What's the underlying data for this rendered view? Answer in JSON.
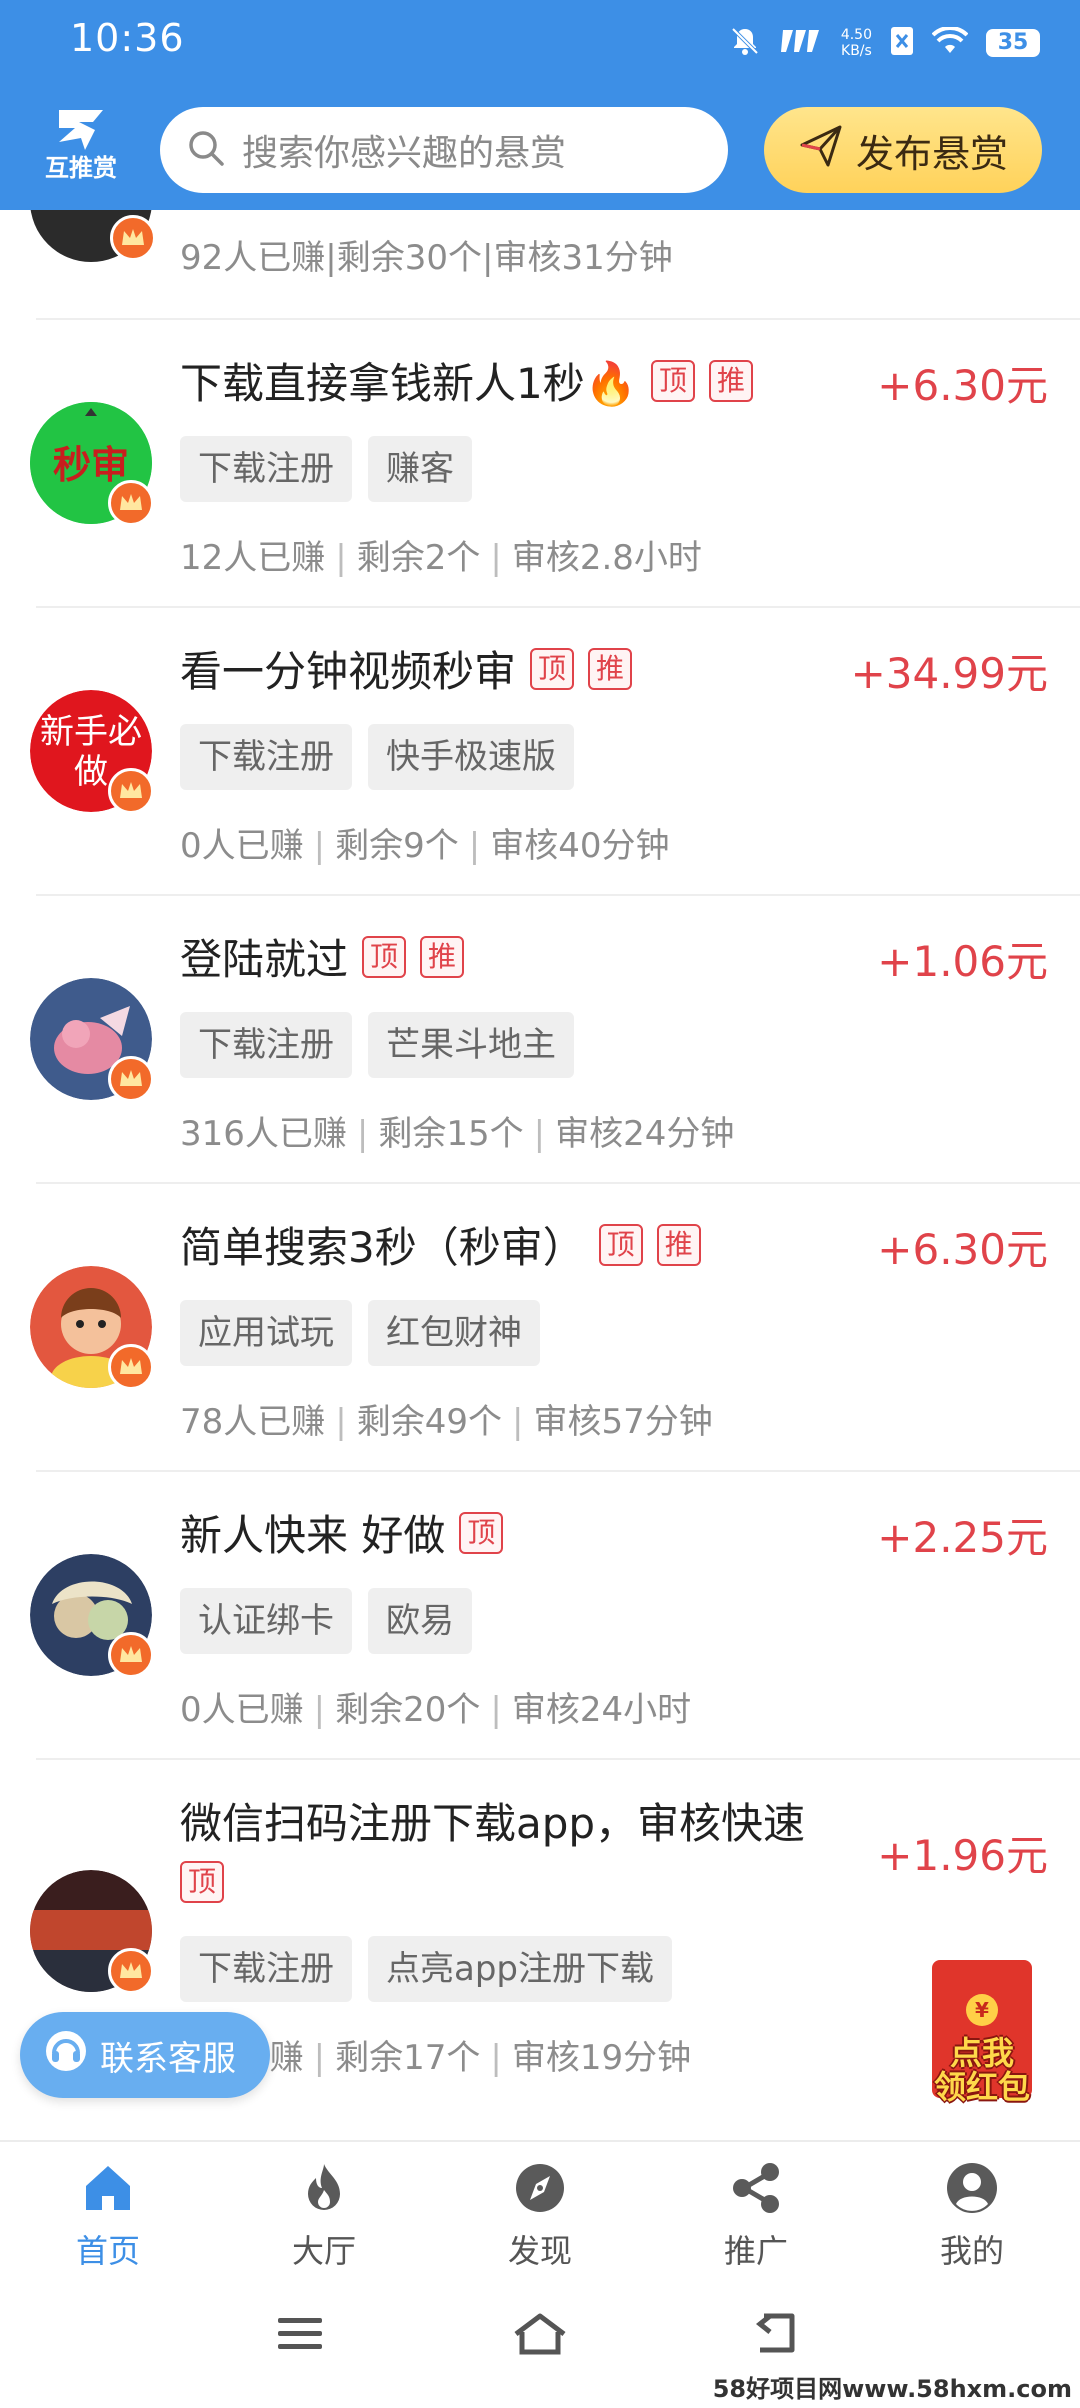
{
  "status_bar": {
    "time": "10:36",
    "net_speed_value": "4.50",
    "net_speed_unit": "KB/s",
    "battery": "35"
  },
  "header": {
    "logo_text": "互推赏",
    "search_placeholder": "搜索你感兴趣的悬赏",
    "publish_label": "发布悬赏"
  },
  "partial_row": {
    "earned": "92人已赚",
    "remaining": "剩余30个",
    "review": "审核31分钟"
  },
  "tasks": [
    {
      "title": "下载直接拿钱新人1秒🔥",
      "badges": [
        "顶",
        "推"
      ],
      "price": "+6.30元",
      "tags": [
        "下载注册",
        "赚客"
      ],
      "earned": "12人已赚",
      "remaining": "剩余2个",
      "review": "审核2.8小时",
      "avatar_text": "秒审"
    },
    {
      "title": "看一分钟视频秒审",
      "badges": [
        "顶",
        "推"
      ],
      "price": "+34.99元",
      "tags": [
        "下载注册",
        "快手极速版"
      ],
      "earned": "0人已赚",
      "remaining": "剩余9个",
      "review": "审核40分钟",
      "avatar_text": "新手必做"
    },
    {
      "title": "登陆就过",
      "badges": [
        "顶",
        "推"
      ],
      "price": "+1.06元",
      "tags": [
        "下载注册",
        "芒果斗地主"
      ],
      "earned": "316人已赚",
      "remaining": "剩余15个",
      "review": "审核24分钟"
    },
    {
      "title": "简单搜索3秒（秒审）",
      "badges": [
        "顶",
        "推"
      ],
      "price": "+6.30元",
      "tags": [
        "应用试玩",
        "红包财神"
      ],
      "earned": "78人已赚",
      "remaining": "剩余49个",
      "review": "审核57分钟"
    },
    {
      "title": "新人快来 好做",
      "badges": [
        "顶"
      ],
      "price": "+2.25元",
      "tags": [
        "认证绑卡",
        "欧易"
      ],
      "earned": "0人已赚",
      "remaining": "剩余20个",
      "review": "审核24小时"
    },
    {
      "title": "微信扫码注册下载app，审核快速",
      "badges": [
        "顶"
      ],
      "price": "+1.96元",
      "tags": [
        "下载注册",
        "点亮app注册下载"
      ],
      "earned": "1人已赚",
      "remaining": "剩余17个",
      "review": "审核19分钟"
    }
  ],
  "floating": {
    "service_label": "联系客服",
    "redpacket_line1": "点我",
    "redpacket_line2": "领红包",
    "redpacket_coin": "¥"
  },
  "tabbar": {
    "items": [
      {
        "label": "首页",
        "icon": "home-icon",
        "active": true
      },
      {
        "label": "大厅",
        "icon": "flame-icon",
        "active": false
      },
      {
        "label": "发现",
        "icon": "compass-icon",
        "active": false
      },
      {
        "label": "推广",
        "icon": "share-icon",
        "active": false
      },
      {
        "label": "我的",
        "icon": "user-icon",
        "active": false
      }
    ]
  },
  "watermark": "58好项目网www.58hxm.com",
  "colors": {
    "brand_blue": "#3d8fe6",
    "price_red": "#e0434a",
    "publish_yellow": "#ffd25a"
  }
}
